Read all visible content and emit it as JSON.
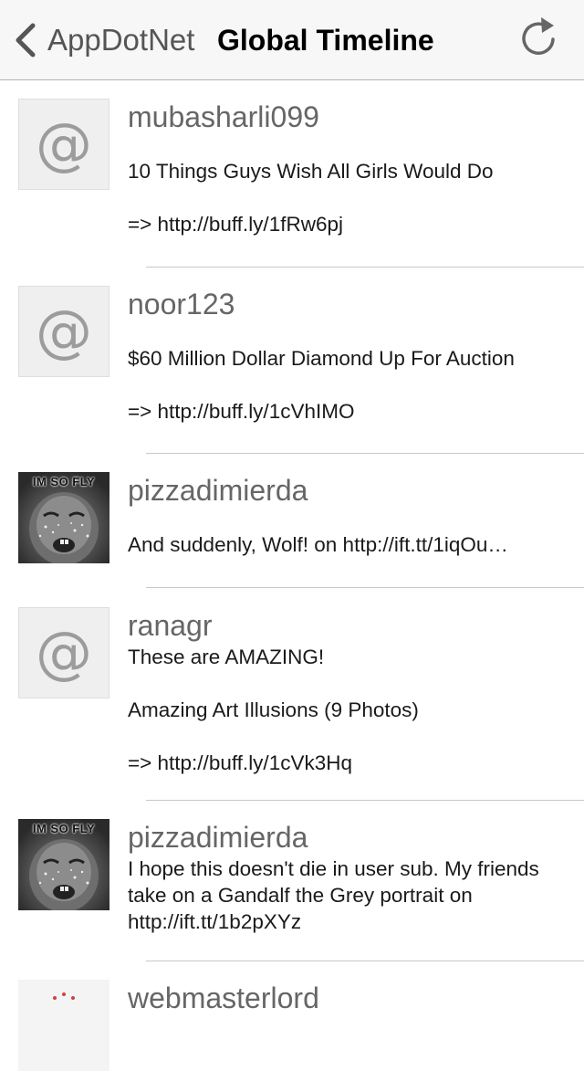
{
  "navbar": {
    "back_label": "AppDotNet",
    "title": "Global Timeline"
  },
  "posts": [
    {
      "username": "mubasharli099",
      "avatar": "placeholder-at-icon",
      "lines": [
        "10 Things Guys Wish All Girls Would Do",
        "",
        "=> http://buff.ly/1fRw6pj"
      ]
    },
    {
      "username": "noor123",
      "avatar": "placeholder-at-icon",
      "lines": [
        "$60 Million Dollar Diamond Up For Auction",
        "",
        "=> http://buff.ly/1cVhIMO"
      ]
    },
    {
      "username": "pizzadimierda",
      "avatar": "photo",
      "avatar_text": "IM SO FLY",
      "lines": [
        "And suddenly, Wolf! on http://ift.tt/1iqOu…"
      ]
    },
    {
      "username": "ranagr",
      "avatar": "placeholder-at-icon",
      "lines": [
        "These are AMAZING!",
        "",
        "Amazing Art Illusions (9 Photos)",
        "",
        "=> http://buff.ly/1cVk3Hq"
      ]
    },
    {
      "username": "pizzadimierda",
      "avatar": "photo",
      "avatar_text": "IM SO FLY",
      "lines": [
        "I hope this doesn't die in user sub. My friends take on a Gandalf the Grey portrait on http://ift.tt/1b2pXYz"
      ]
    },
    {
      "username": "webmasterlord",
      "avatar": "photo-partial",
      "lines": []
    }
  ],
  "placeholder_glyph": "@",
  "colors": {
    "navbar_bg": "#f7f7f7",
    "separator": "#c8c7cc",
    "username": "#666666",
    "back_text": "#555555"
  }
}
